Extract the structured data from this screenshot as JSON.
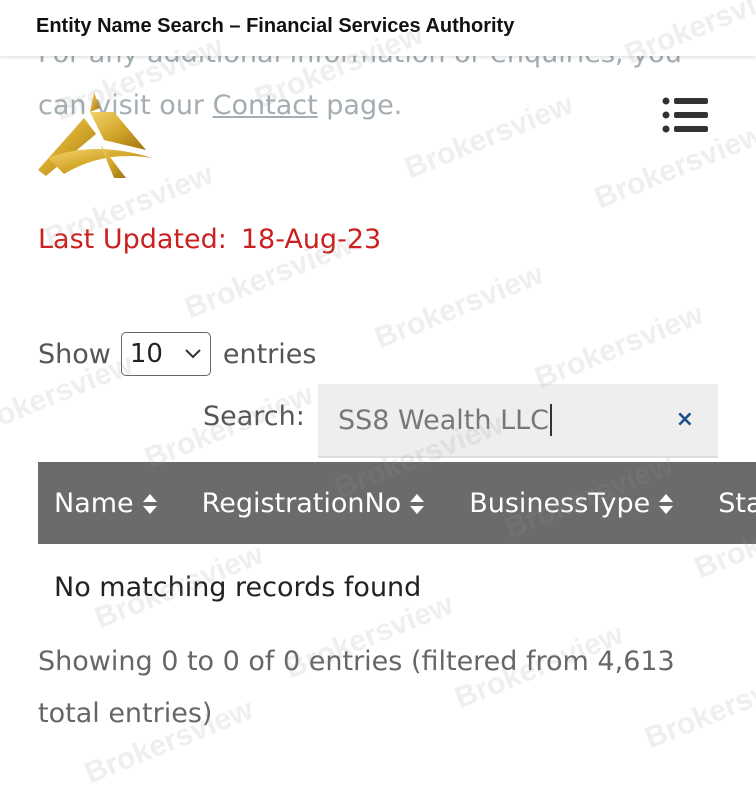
{
  "header": {
    "title": "Entity Name Search – Financial Services Authority"
  },
  "intro": {
    "line1": "For any additional information or enquiries, you",
    "prefix": "can visit our ",
    "link": "Contact",
    "suffix": " page."
  },
  "menu": {
    "icon": "list-menu-icon"
  },
  "logo": {
    "icon": "gold-logo-icon"
  },
  "last_updated": {
    "label": "Last Updated:",
    "date": "18-Aug-23"
  },
  "length": {
    "show": "Show",
    "value": "10",
    "entries": "entries"
  },
  "search": {
    "label": "Search:",
    "value": "SS8 Wealth LLC",
    "clear": "×"
  },
  "table": {
    "columns": [
      "Name",
      "RegistrationNo",
      "BusinessType",
      "Statu"
    ],
    "empty": "No matching records found"
  },
  "info": "Showing 0 to 0 of 0 entries (filtered from 4,613 total entries)",
  "watermark": "Brokersview",
  "colors": {
    "header_bg": "#6b6b6b",
    "alert": "#cc1f1f",
    "search_bg": "#eeeeee",
    "logo_gold": "#d4a62a"
  }
}
